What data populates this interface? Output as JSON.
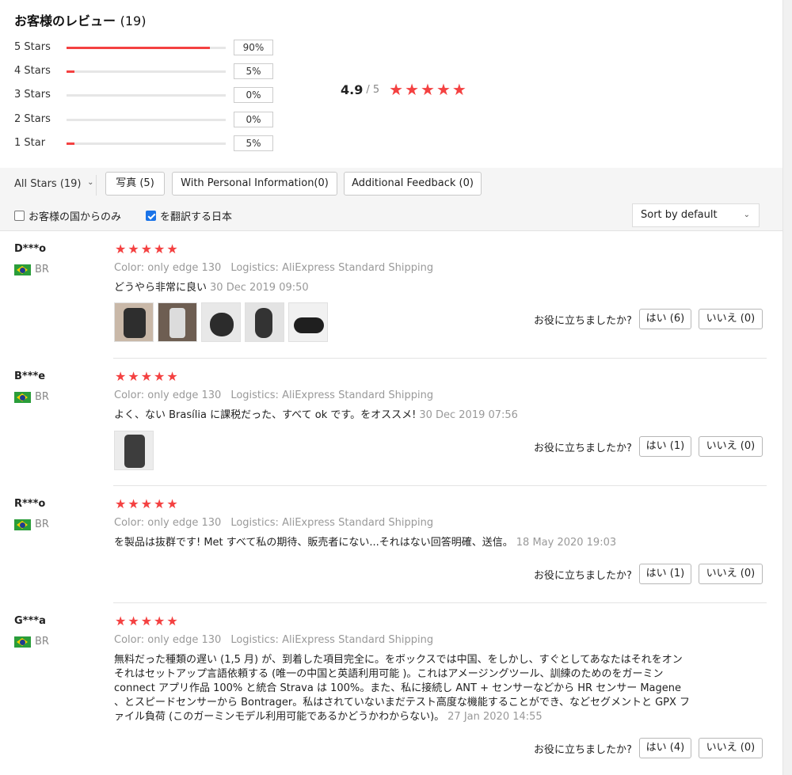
{
  "summary": {
    "title": "お客様のレビュー",
    "count": "(19)",
    "distribution": [
      {
        "label": "5 Stars",
        "fraction": 0.9,
        "pct": "90%"
      },
      {
        "label": "4 Stars",
        "fraction": 0.05,
        "pct": "5%"
      },
      {
        "label": "3 Stars",
        "fraction": 0.0,
        "pct": "0%"
      },
      {
        "label": "2 Stars",
        "fraction": 0.0,
        "pct": "0%"
      },
      {
        "label": "1 Star",
        "fraction": 0.05,
        "pct": "5%"
      }
    ],
    "average": "4.9",
    "out_of": "/ 5",
    "star_rating": 5
  },
  "filters": {
    "all_stars": "All Stars (19)",
    "photos": "写真 (5)",
    "personal_info": "With Personal Information(0)",
    "additional_feedback": "Additional Feedback (0)",
    "country_only": "お客様の国からのみ",
    "country_only_checked": false,
    "translate": "を翻訳する日本",
    "translate_checked": true,
    "sort": "Sort by default"
  },
  "helpful_question": "お役に立ちましたか?",
  "reviews": [
    {
      "name": "D***o",
      "country": "BR",
      "stars": 5,
      "color_label": "Color:",
      "color_value": "only edge 130",
      "logistics_label": "Logistics:",
      "logistics_value": "AliExpress Standard Shipping",
      "text": "どうやら非常に良い",
      "date": "30 Dec 2019 09:50",
      "photo_count": 5,
      "yes": "はい (6)",
      "no": "いいえ (0)"
    },
    {
      "name": "B***e",
      "country": "BR",
      "stars": 5,
      "color_label": "Color:",
      "color_value": "only edge 130",
      "logistics_label": "Logistics:",
      "logistics_value": "AliExpress Standard Shipping",
      "text": "よく、ない Brasília に課税だった、すべて ok です。をオススメ!",
      "date": "30 Dec 2019 07:56",
      "photo_count": 1,
      "yes": "はい (1)",
      "no": "いいえ (0)"
    },
    {
      "name": "R***o",
      "country": "BR",
      "stars": 5,
      "color_label": "Color:",
      "color_value": "only edge 130",
      "logistics_label": "Logistics:",
      "logistics_value": "AliExpress Standard Shipping",
      "text": "を製品は抜群です! Met すべて私の期待、販売者にない...それはない回答明確、送信。",
      "date": "18 May 2020 19:03",
      "photo_count": 0,
      "yes": "はい (1)",
      "no": "いいえ (0)"
    },
    {
      "name": "G***a",
      "country": "BR",
      "stars": 5,
      "color_label": "Color:",
      "color_value": "only edge 130",
      "logistics_label": "Logistics:",
      "logistics_value": "AliExpress Standard Shipping",
      "text": "無料だった種類の遅い (1,5 月) が、到着した項目完全に。をボックスでは中国、をしかし、すぐとしてあなたはそれをオンそれはセットアップ言語依頼する (唯一の中国と英語利用可能 )。これはアメージングツール、訓練のためのをガーミン connect アプリ作品 100% と統合 Strava は 100%。また、私に接続し ANT + センサーなどから HR センサー Magene 、とスピードセンサーから Bontrager。私はされていないまだテスト高度な機能することができ、などセグメントと GPX ファイル負荷 (このガーミンモデル利用可能であるかどうかわからない)。",
      "date": "27 Jan 2020 14:55",
      "photo_count": 0,
      "yes": "はい (4)",
      "no": "いいえ (0)"
    }
  ]
}
